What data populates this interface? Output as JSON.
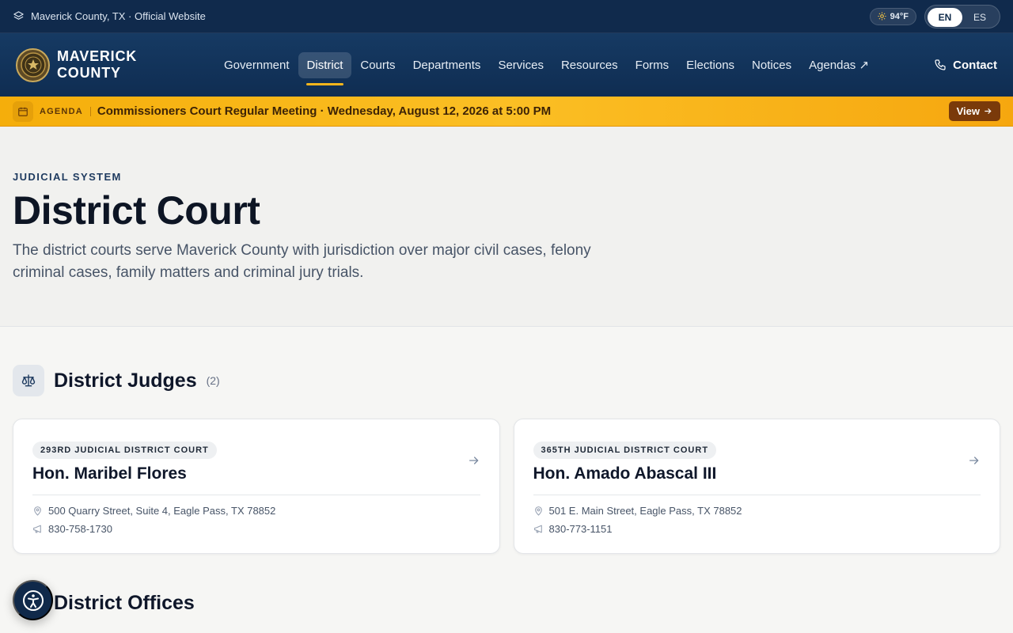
{
  "topbar": {
    "site_label": "Maverick County, TX · Official Website",
    "weather": "94°F",
    "languages": [
      "EN",
      "ES"
    ],
    "active_language": "EN"
  },
  "header": {
    "brand_line1": "MAVERICK",
    "brand_line2": "COUNTY",
    "nav": [
      "Government",
      "District",
      "Courts",
      "Departments",
      "Services",
      "Resources",
      "Forms",
      "Elections",
      "Notices",
      "Agendas ↗"
    ],
    "active_nav": "District",
    "contact_label": "Contact"
  },
  "alert": {
    "tag": "AGENDA",
    "text": "Commissioners Court Regular Meeting · Wednesday, August 12, 2026 at 5:00 PM",
    "button": "View"
  },
  "hero": {
    "eyebrow": "JUDICIAL SYSTEM",
    "title": "District Court",
    "description": "The district courts serve Maverick County with jurisdiction over major civil cases, felony criminal cases, family matters and criminal jury trials."
  },
  "judges_section": {
    "title": "District Judges",
    "count": "(2)",
    "cards": [
      {
        "court": "293RD JUDICIAL DISTRICT COURT",
        "name": "Hon. Maribel Flores",
        "address": "500 Quarry Street, Suite 4, Eagle Pass, TX 78852",
        "phone": "830-758-1730"
      },
      {
        "court": "365TH JUDICIAL DISTRICT COURT",
        "name": "Hon. Amado Abascal III",
        "address": "501 E. Main Street, Eagle Pass, TX 78852",
        "phone": "830-773-1151"
      }
    ]
  },
  "offices_section": {
    "title": "District Offices"
  },
  "colors": {
    "navy": "#0f2d52",
    "accent": "#f3b51c",
    "alert": "#fbbf24"
  }
}
